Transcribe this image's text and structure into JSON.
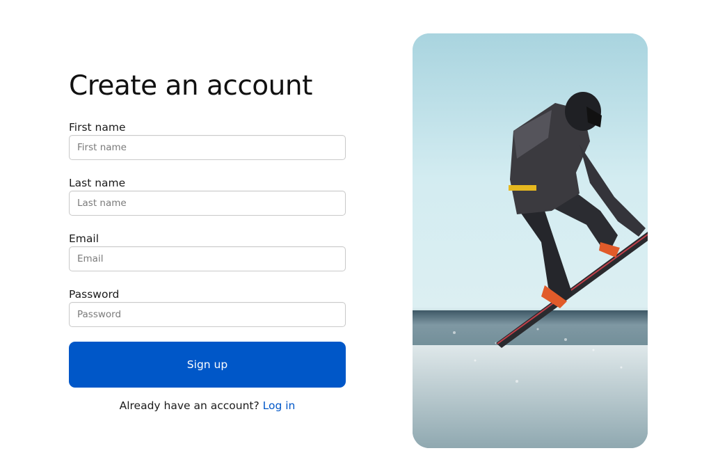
{
  "form": {
    "title": "Create an account",
    "fields": [
      {
        "label": "First name",
        "placeholder": "First name"
      },
      {
        "label": "Last name",
        "placeholder": "Last name"
      },
      {
        "label": "Email",
        "placeholder": "Email"
      },
      {
        "label": "Password",
        "placeholder": "Password"
      }
    ],
    "submit_label": "Sign up",
    "login_prompt": "Already have an account?",
    "login_link": "Log in"
  },
  "colors": {
    "accent": "#0057c8",
    "input_border": "#c9c9c9",
    "text": "#1a1a1a"
  }
}
